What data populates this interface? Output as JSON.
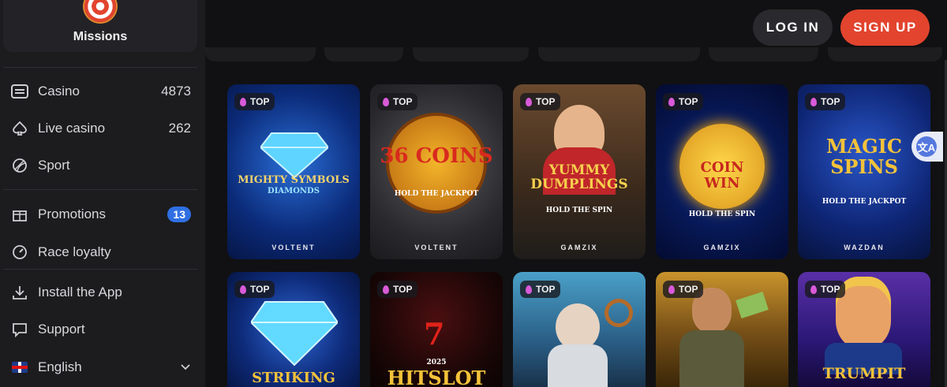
{
  "sidebar": {
    "missions_label": "Missions",
    "items": [
      {
        "name": "casino",
        "label": "Casino",
        "count": "4873",
        "icon": "slot-machine-icon"
      },
      {
        "name": "live-casino",
        "label": "Live casino",
        "count": "262",
        "icon": "spade-icon"
      },
      {
        "name": "sport",
        "label": "Sport",
        "icon": "ball-icon"
      },
      {
        "name": "promotions",
        "label": "Promotions",
        "badge": "13",
        "icon": "gift-icon"
      },
      {
        "name": "race-loyalty",
        "label": "Race loyalty",
        "icon": "gauge-icon"
      },
      {
        "name": "install-app",
        "label": "Install the App",
        "icon": "download-icon"
      },
      {
        "name": "support",
        "label": "Support",
        "icon": "chat-icon"
      },
      {
        "name": "language",
        "label": "English",
        "icon": "uk-flag-icon"
      }
    ]
  },
  "header": {
    "login_label": "LOG IN",
    "signup_label": "SIGN UP"
  },
  "colors": {
    "accent": "#e2442e",
    "badge": "#2f6fe3",
    "top_flame": "#d85ad8"
  },
  "tiles": [
    {
      "badge": "TOP",
      "title": "MIGHTY SYMBOLS",
      "subtitle": "DIAMONDS",
      "provider": "VOLTENT"
    },
    {
      "badge": "TOP",
      "title": "36 COINS",
      "subtitle": "HOLD THE JACKPOT",
      "provider": "VOLTENT"
    },
    {
      "badge": "TOP",
      "title": "YUMMY DUMPLINGS",
      "subtitle": "HOLD THE SPIN",
      "provider": "GAMZIX"
    },
    {
      "badge": "TOP",
      "title": "COIN WIN",
      "subtitle": "HOLD THE SPIN",
      "provider": "GAMZIX"
    },
    {
      "badge": "TOP",
      "title": "MAGIC SPINS",
      "subtitle": "HOLD THE JACKPOT",
      "provider": "WAZDAN"
    },
    {
      "badge": "TOP",
      "title": "STRIKING",
      "provider": ""
    },
    {
      "badge": "TOP",
      "title": "HITSLOT",
      "subtitle": "2025",
      "provider": ""
    },
    {
      "badge": "TOP",
      "title": "",
      "provider": ""
    },
    {
      "badge": "TOP",
      "title": "",
      "provider": ""
    },
    {
      "badge": "TOP",
      "title": "TRUMPIT",
      "provider": ""
    }
  ]
}
